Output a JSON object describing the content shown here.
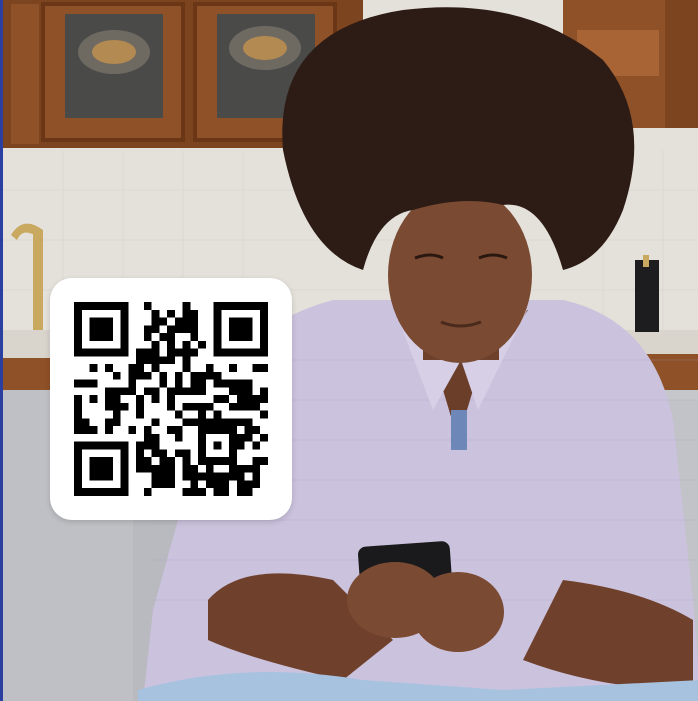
{
  "scene": {
    "description_icon": "qr-code-icon",
    "palette": {
      "cabinet": "#8a4a22",
      "wall": "#e6e2dc",
      "sofa": "#c9cacd",
      "shirt": "#cbc2de",
      "skin": "#7a4a32",
      "hair": "#2d1c15",
      "phone": "#1a1a1c",
      "qr_dark": "#000000",
      "qr_light": "#ffffff"
    }
  }
}
